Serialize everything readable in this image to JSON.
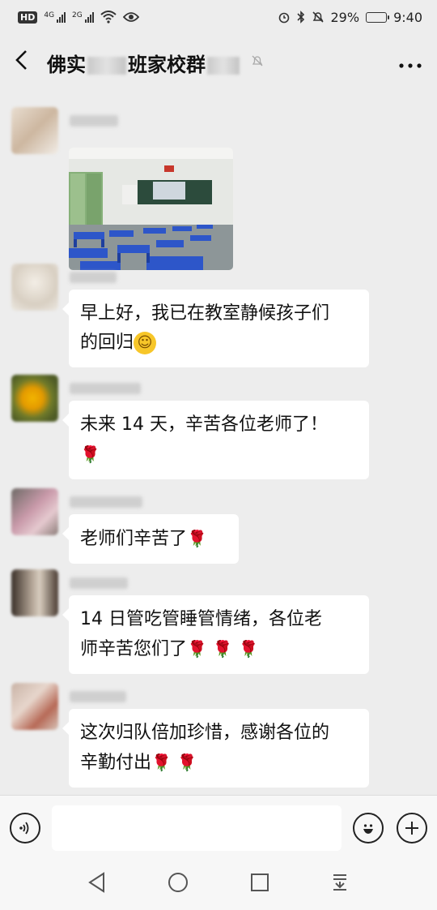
{
  "status_bar": {
    "hd": "HD",
    "net1": "4G",
    "net2": "2G",
    "battery_text": "29%",
    "battery_level": 0.29,
    "time": "9:40"
  },
  "header": {
    "back_icon": "chevron-left-icon",
    "title_part1": "佛实",
    "title_part2": "班家校群",
    "mute_icon": "bell-off-icon",
    "more_icon": "more-icon"
  },
  "messages": [
    {
      "type": "image",
      "image_desc": "classroom-photo"
    },
    {
      "type": "text",
      "lines": [
        "早上好，我已在教室静候孩子们",
        "的回归"
      ],
      "emoji": "smile"
    },
    {
      "type": "text",
      "lines": [
        "未来 14 天，辛苦各位老师了！",
        ""
      ],
      "roses": 1
    },
    {
      "type": "text",
      "lines": [
        "老师们辛苦了"
      ],
      "roses": 1
    },
    {
      "type": "text",
      "lines": [
        "14 日管吃管睡管情绪，各位老",
        "师辛苦您们了"
      ],
      "roses": 3
    },
    {
      "type": "text",
      "lines": [
        "这次归队倍加珍惜，感谢各位的",
        "辛勤付出"
      ],
      "roses": 2
    }
  ],
  "input_bar": {
    "voice_icon": "voice-icon",
    "emoji_icon": "emoji-icon",
    "plus_icon": "plus-icon",
    "input_value": ""
  },
  "nav_bar": {
    "back": "nav-back-icon",
    "home": "nav-home-icon",
    "recent": "nav-recent-icon",
    "notifications": "nav-notification-icon"
  }
}
